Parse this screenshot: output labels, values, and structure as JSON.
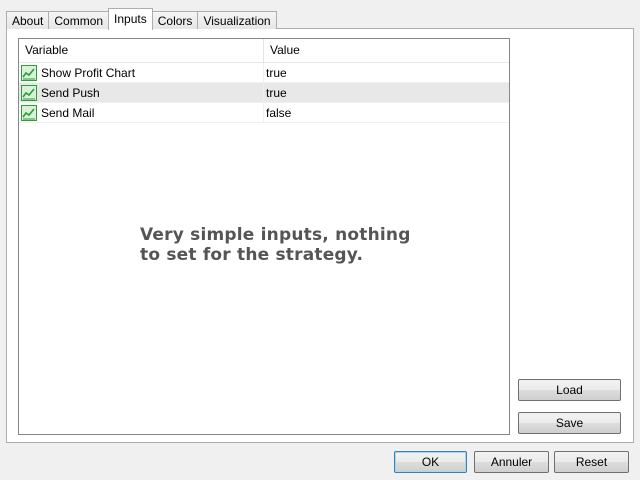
{
  "tabs": [
    "About",
    "Common",
    "Inputs",
    "Colors",
    "Visualization"
  ],
  "active_tab": "Inputs",
  "inputs_table": {
    "columns": [
      "Variable",
      "Value"
    ],
    "rows": [
      {
        "variable": "Show Profit Chart",
        "value": "true",
        "icon": "bool-param-icon"
      },
      {
        "variable": "Send Push",
        "value": "true",
        "icon": "bool-param-icon"
      },
      {
        "variable": "Send Mail",
        "value": "false",
        "icon": "bool-param-icon"
      }
    ]
  },
  "overlay_text": {
    "line1": "Very simple inputs, nothing",
    "line2": "to set for the strategy."
  },
  "buttons": {
    "load": "Load",
    "save": "Save",
    "ok": "OK",
    "cancel": "Annuler",
    "reset": "Reset"
  },
  "colors": {
    "icon_green": "#2e9c3a",
    "default_button_border": "#3c7fb1"
  }
}
